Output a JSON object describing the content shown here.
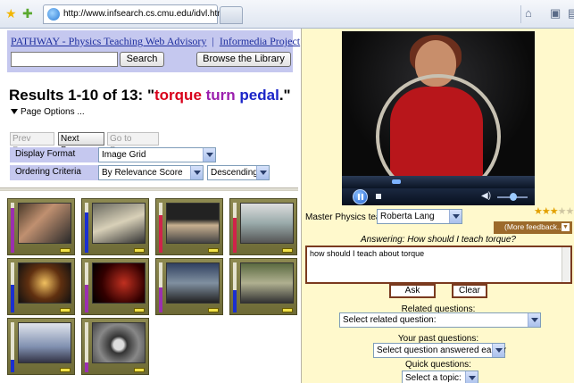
{
  "browser": {
    "url": "http://www.infsearch.cs.cmu.edu/idvl.htm"
  },
  "header": {
    "link_pathway": "PATHWAY - Physics Teaching Web Advisory",
    "separator": "|",
    "link_informedia": "Informedia Project",
    "search_value": "",
    "search_button": "Search",
    "browse_button": "Browse the Library"
  },
  "results": {
    "prefix": "Results 1-10 of 13: \"",
    "word1": "torque",
    "word2": "turn",
    "word3": "pedal",
    "suffix": ".\"",
    "page_options": "Page Options ..."
  },
  "pager": {
    "prev": "Prev Page",
    "next": "Next Page",
    "goto": "Go to Page..."
  },
  "options": {
    "display_label": "Display Format",
    "display_value": "Image Grid",
    "order_label": "Ordering Criteria",
    "order_value": "By Relevance Score",
    "direction_value": "Descending"
  },
  "thumbnails": [
    {
      "relevance": 0.9,
      "bar_color": "#9b2fb0"
    },
    {
      "relevance": 0.8,
      "bar_color": "#1b2fcf"
    },
    {
      "relevance": 0.75,
      "bar_color": "#d0234a"
    },
    {
      "relevance": 0.7,
      "bar_color": "#d0234a"
    },
    {
      "relevance": 0.55,
      "bar_color": "#1b2fcf"
    },
    {
      "relevance": 0.55,
      "bar_color": "#9b2fb0"
    },
    {
      "relevance": 0.5,
      "bar_color": "#9b2fb0"
    },
    {
      "relevance": 0.45,
      "bar_color": "#1b2fcf"
    },
    {
      "relevance": 0.25,
      "bar_color": "#1b2fcf"
    },
    {
      "relevance": 0.2,
      "bar_color": "#9b2fb0"
    }
  ],
  "advisor": {
    "teacher_label": "Master Physics teacher:",
    "teacher_value": "Roberta Lang",
    "rating_stars": 3,
    "rating_max": 5,
    "feedback": "(More feedback...)",
    "answering": "Answering: How should I teach torque?",
    "question_text": "how should I teach about torque",
    "ask_button": "Ask",
    "clear_button": "Clear",
    "related_label": "Related questions:",
    "related_value": "Select related question:",
    "past_label": "Your past questions:",
    "past_value": "Select question answered earlier",
    "quick_label": "Quick questions:",
    "quick_value": "Select a topic:"
  }
}
